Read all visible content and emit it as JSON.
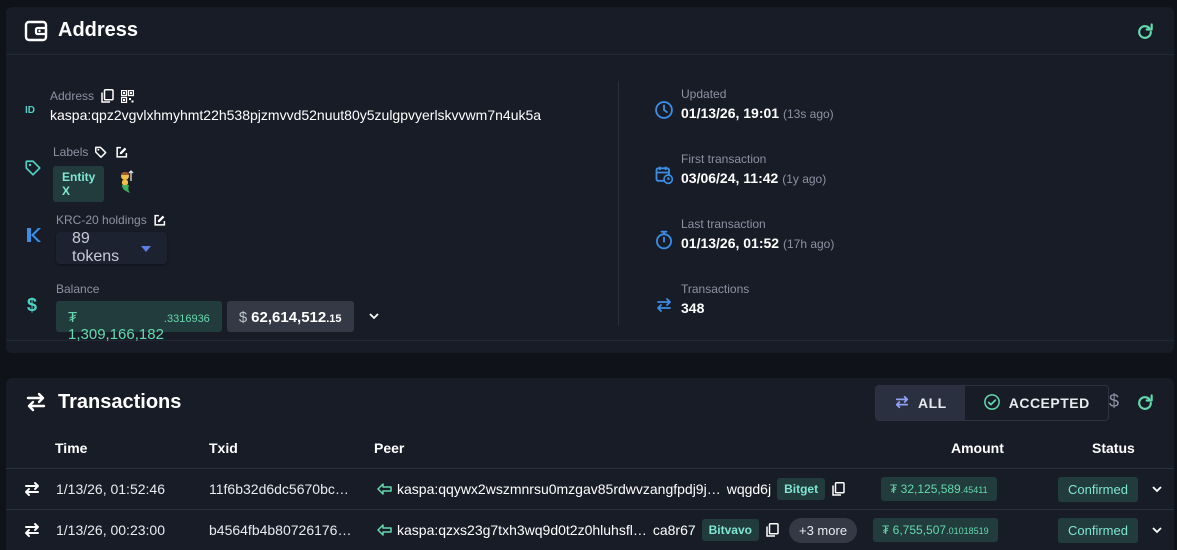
{
  "address_card": {
    "title": "Address",
    "address": {
      "label": "Address",
      "value": "kaspa:qpz2vgvlxhmyhmt22h538pjzmvvd52nuut80y5zulgpvyerlskvvwm7n4uk5a"
    },
    "labels": {
      "label": "Labels",
      "tag": "Entity X"
    },
    "krc20": {
      "label": "KRC-20 holdings",
      "dropdown": "89 tokens"
    },
    "balance": {
      "label": "Balance",
      "kas_main": "₮ 1,309,166,182",
      "kas_decimals": ".3316936",
      "usd_symbol": "$",
      "usd_main": "62,614,512",
      "usd_decimals": ".15"
    },
    "updated": {
      "label": "Updated",
      "value": "01/13/26, 19:01",
      "ago": "(13s ago)"
    },
    "first_tx": {
      "label": "First transaction",
      "value": "03/06/24, 11:42",
      "ago": "(1y ago)"
    },
    "last_tx": {
      "label": "Last transaction",
      "value": "01/13/26, 01:52",
      "ago": "(17h ago)"
    },
    "tx_count": {
      "label": "Transactions",
      "value": "348"
    }
  },
  "transactions_card": {
    "title": "Transactions",
    "filters": [
      {
        "label": "ALL",
        "active": true
      },
      {
        "label": "ACCEPTED",
        "active": false
      }
    ],
    "currency_toggle": "$",
    "columns": {
      "time": "Time",
      "txid": "Txid",
      "peer": "Peer",
      "amount": "Amount",
      "status": "Status"
    },
    "rows": [
      {
        "time": "1/13/26, 01:52:46",
        "txid": "11f6b32d6dc5670bc…",
        "peer": "kaspa:qqywx2wszmnrsu0mzgav85rdwvzangfpdj9j…",
        "peer_suffix": "wqgd6j",
        "peer_tag": "Bitget",
        "more": "",
        "amount_main": "₮ 32,125,589",
        "amount_decimals": ".45411",
        "status": "Confirmed"
      },
      {
        "time": "1/13/26, 00:23:00",
        "txid": "b4564fb4b80726176…",
        "peer": "kaspa:qzxs23g7txh3wq9d0t2z0hluhsfl…",
        "peer_suffix": "ca8r67",
        "peer_tag": "Bitvavo",
        "more": "+3 more",
        "amount_main": "₮ 6,755,507",
        "amount_decimals": ".01018519",
        "status": "Confirmed"
      }
    ]
  },
  "colors": {
    "accent": "#63d9ad",
    "icon_blue": "#3a8ee6",
    "teal_icon": "#4fd1c5",
    "bg": "#0f1218",
    "card": "#181c26"
  }
}
